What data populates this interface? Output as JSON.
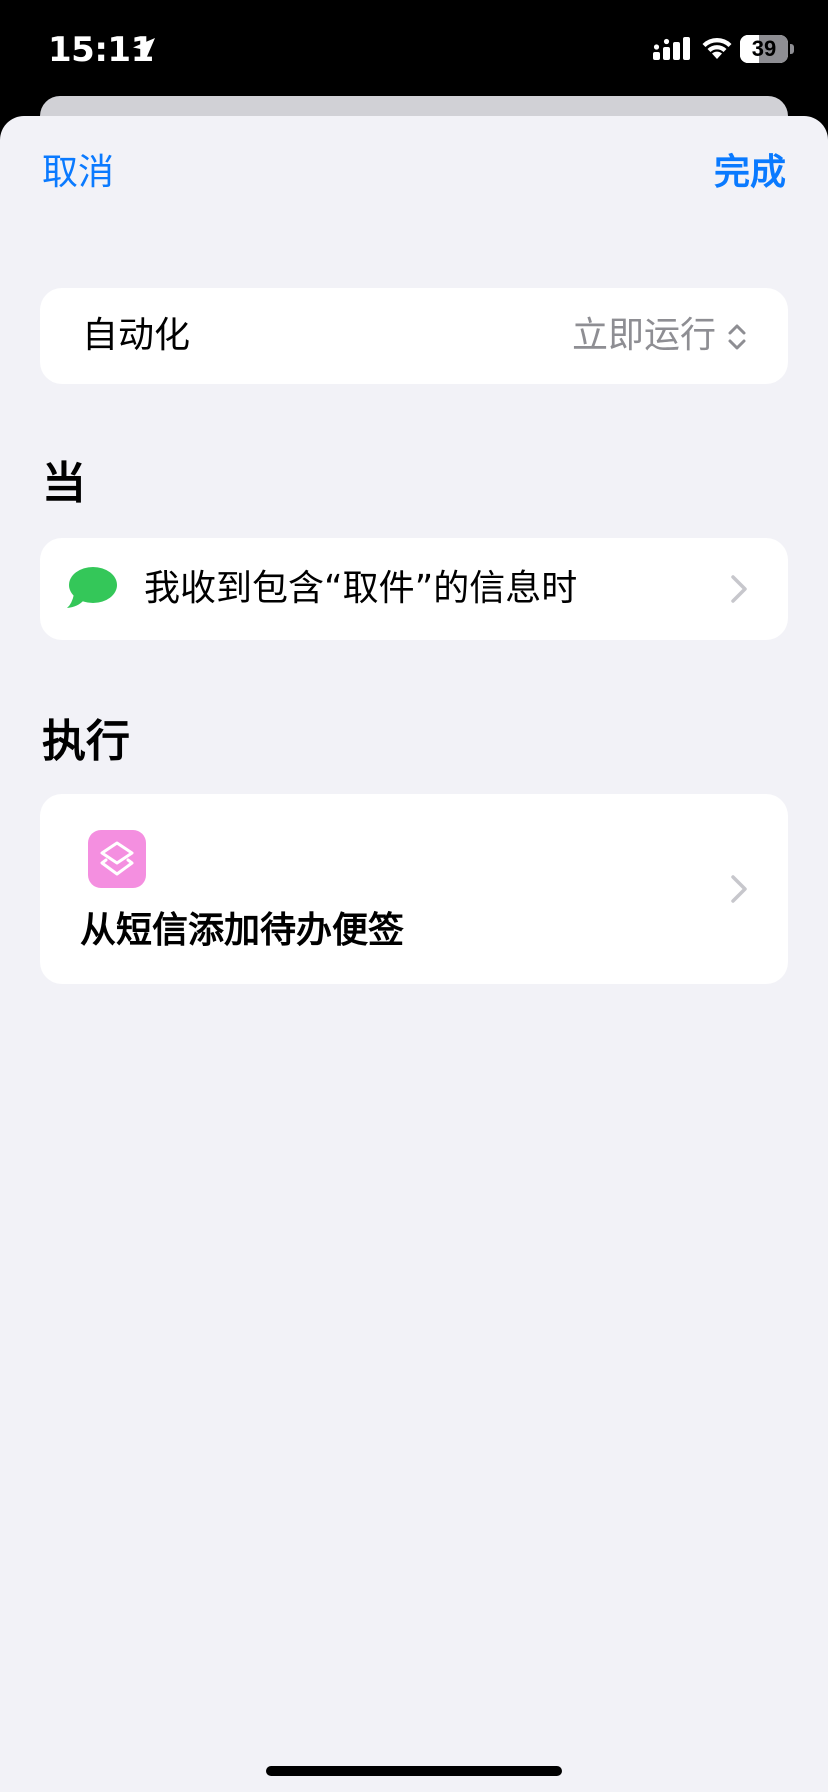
{
  "status_bar": {
    "time": "15:11",
    "battery_level": "39",
    "battery_fraction": 0.39,
    "icons": [
      "location-arrow-icon",
      "cellular-signal-icon",
      "wifi-icon",
      "battery-icon"
    ]
  },
  "nav": {
    "cancel_label": "取消",
    "done_label": "完成"
  },
  "automation_row": {
    "label": "自动化",
    "value": "立即运行",
    "icon": "chevron-up-down-icon"
  },
  "when_section": {
    "title": "当",
    "trigger_text": "我收到包含“取件”的信息时",
    "icon": "messages-bubble-icon"
  },
  "do_section": {
    "title": "执行",
    "action_text": "从短信添加待办便签",
    "icon": "shortcuts-app-icon"
  },
  "colors": {
    "accent": "#0a7aff",
    "background": "#f2f2f7",
    "card": "#ffffff",
    "secondary_text": "#8e8e93",
    "messages_green": "#34c759",
    "shortcut_pink": "#f48fe0"
  }
}
